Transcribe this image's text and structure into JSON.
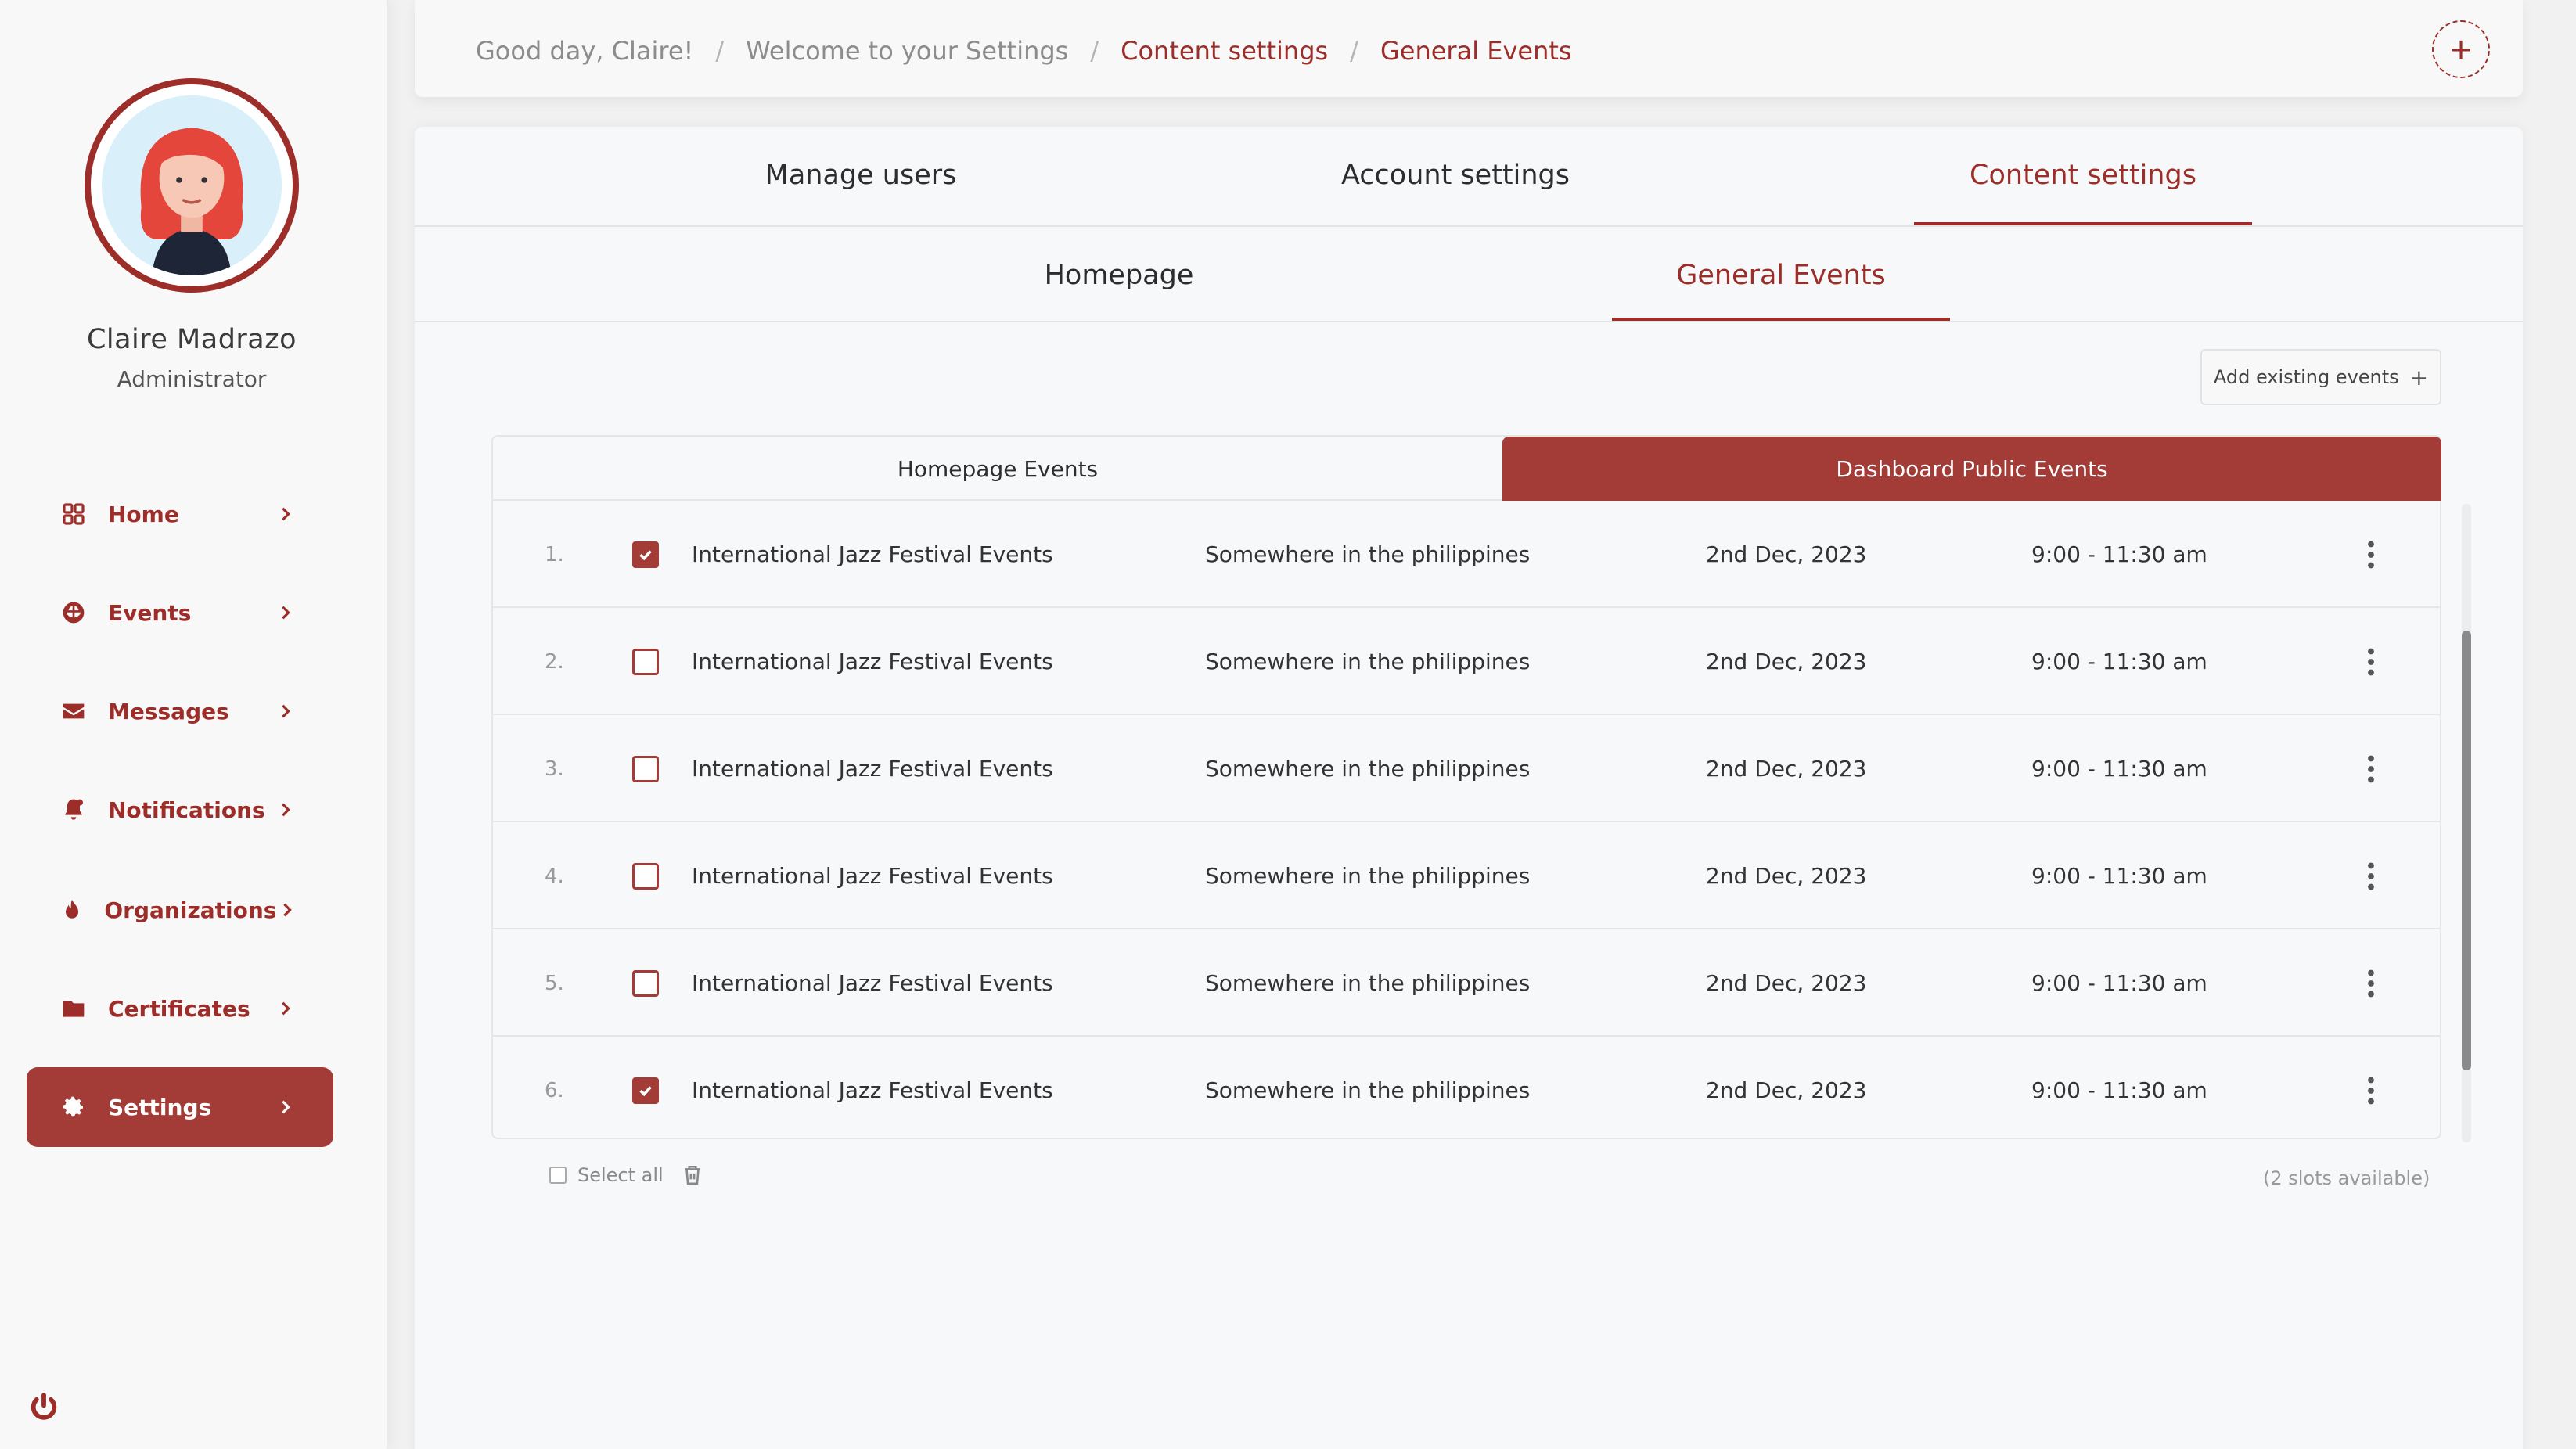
{
  "profile": {
    "name": "Claire Madrazo",
    "role": "Administrator"
  },
  "nav": {
    "items": [
      {
        "label": "Home",
        "icon": "grid-icon"
      },
      {
        "label": "Events",
        "icon": "globe-icon"
      },
      {
        "label": "Messages",
        "icon": "envelope-icon"
      },
      {
        "label": "Notifications",
        "icon": "bell-icon"
      },
      {
        "label": "Organizations",
        "icon": "flame-icon"
      },
      {
        "label": "Certificates",
        "icon": "folder-icon"
      },
      {
        "label": "Settings",
        "icon": "gear-icon",
        "active": true
      }
    ]
  },
  "breadcrumb": {
    "greeting": "Good day, Claire!",
    "welcome": "Welcome to your Settings",
    "section": "Content settings",
    "current": "General Events"
  },
  "tabs": {
    "primary": [
      "Manage users",
      "Account settings",
      "Content settings"
    ],
    "primary_active": "Content settings",
    "secondary": [
      "Homepage",
      "General Events"
    ],
    "secondary_active": "General Events"
  },
  "actions": {
    "add_existing": "Add existing events",
    "add_existing_plus": "+",
    "add_circle": "+"
  },
  "event_tabs": {
    "homepage": "Homepage Events",
    "dashboard": "Dashboard Public Events",
    "active": "Dashboard Public Events"
  },
  "events": [
    {
      "num": "1.",
      "checked": true,
      "name": "International Jazz Festival Events",
      "location": "Somewhere in the philippines",
      "date": "2nd Dec, 2023",
      "time": "9:00 - 11:30 am"
    },
    {
      "num": "2.",
      "checked": false,
      "name": "International Jazz Festival Events",
      "location": "Somewhere in the philippines",
      "date": "2nd Dec, 2023",
      "time": "9:00 - 11:30 am"
    },
    {
      "num": "3.",
      "checked": false,
      "name": "International Jazz Festival Events",
      "location": "Somewhere in the philippines",
      "date": "2nd Dec, 2023",
      "time": "9:00 - 11:30 am"
    },
    {
      "num": "4.",
      "checked": false,
      "name": "International Jazz Festival Events",
      "location": "Somewhere in the philippines",
      "date": "2nd Dec, 2023",
      "time": "9:00 - 11:30 am"
    },
    {
      "num": "5.",
      "checked": false,
      "name": "International Jazz Festival Events",
      "location": "Somewhere in the philippines",
      "date": "2nd Dec, 2023",
      "time": "9:00 - 11:30 am"
    },
    {
      "num": "6.",
      "checked": true,
      "name": "International Jazz Festival Events",
      "location": "Somewhere in the philippines",
      "date": "2nd Dec, 2023",
      "time": "9:00 - 11:30 am"
    }
  ],
  "footer": {
    "select_all": "Select all",
    "slots": "(2 slots available)"
  },
  "colors": {
    "accent": "#a33b36",
    "accent_dark": "#9c2d28",
    "background": "#f1f1f2",
    "panel": "#f7f8f9"
  }
}
